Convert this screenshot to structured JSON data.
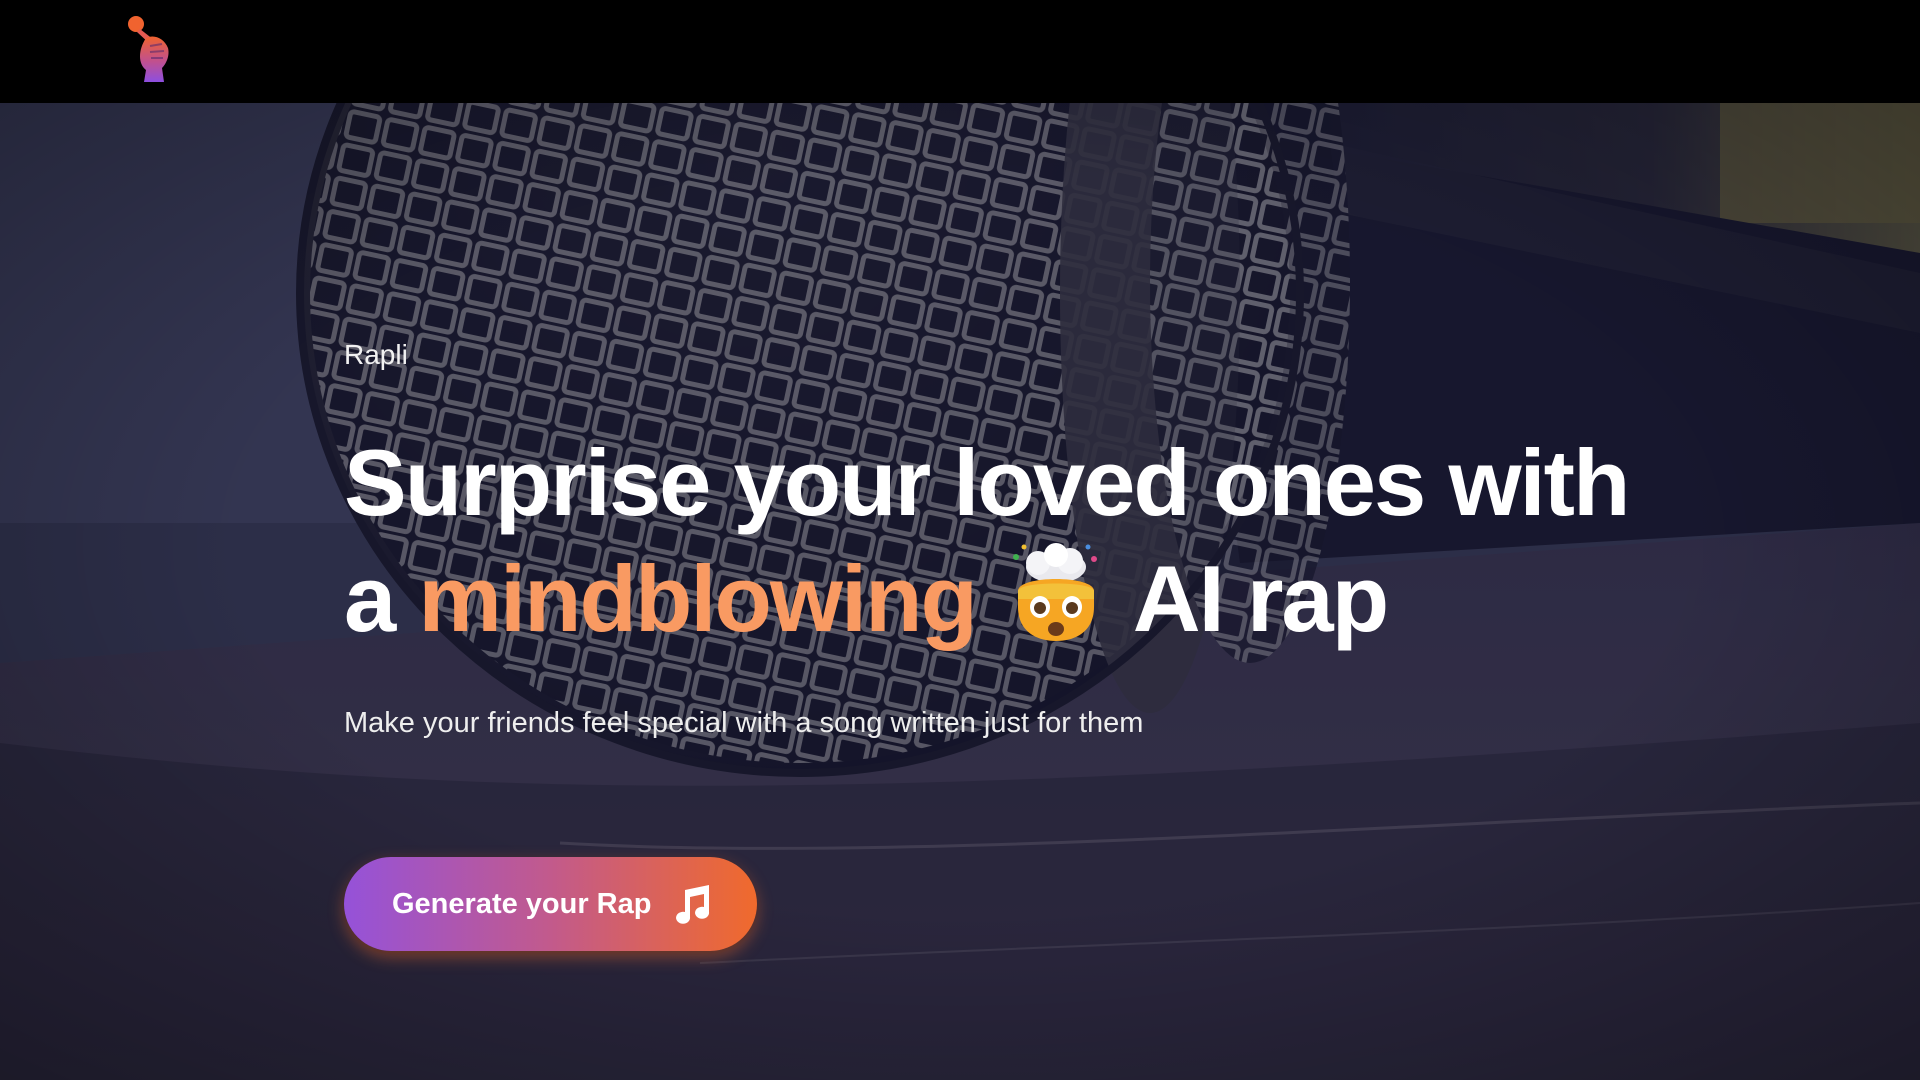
{
  "brand": {
    "logo_icon": "microphone-fist-icon"
  },
  "hero": {
    "eyebrow": "Rapli",
    "headline_line1": "Surprise your loved ones with",
    "headline_line2_prefix": "a",
    "headline_accent": "mindblowing",
    "headline_emoji": "exploding-head-emoji",
    "headline_line2_suffix": "AI rap",
    "subtitle": "Make your friends feel special with a song written just for them",
    "cta_label": "Generate your Rap",
    "cta_icon": "music-note-icon"
  },
  "colors": {
    "accent": "#f99a62",
    "cta_gradient_start": "#9552d9",
    "cta_gradient_end": "#f06a2c",
    "nav_background": "#000000"
  }
}
